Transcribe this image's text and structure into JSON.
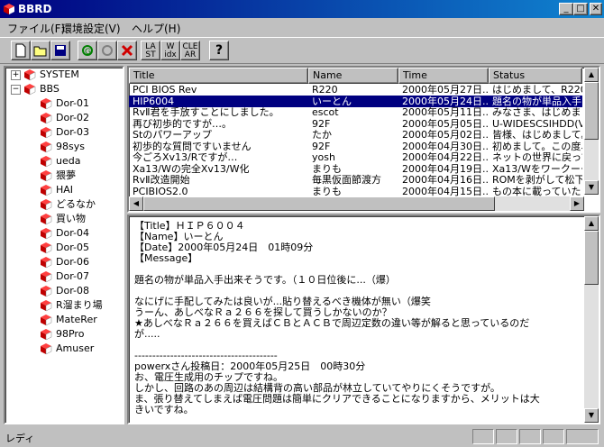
{
  "window": {
    "title": "BBRD"
  },
  "menu": [
    {
      "label": "ファイル(F)"
    },
    {
      "label": "環境設定(V)"
    },
    {
      "label": "ヘルプ(H)"
    }
  ],
  "toolbar": {
    "buttons": [
      {
        "icon": "new-file-icon"
      },
      {
        "icon": "open-folder-icon"
      },
      {
        "icon": "save-icon"
      },
      {
        "icon": "refresh-green-icon"
      },
      {
        "icon": "refresh-gray-icon"
      },
      {
        "icon": "delete-red-x-icon",
        "color": "#d00000"
      },
      {
        "icon": "last-icon",
        "label": "LA ST"
      },
      {
        "icon": "index-icon",
        "label": "W idx"
      },
      {
        "icon": "clear-icon",
        "label": "CLE AR"
      },
      {
        "icon": "help-icon",
        "label": "?"
      }
    ]
  },
  "tree": {
    "root1": "SYSTEM",
    "root2": "BBS",
    "children": [
      "Dor-01",
      "Dor-02",
      "Dor-03",
      "98sys",
      "ueda",
      "猥夢",
      "HAI",
      "どるなか",
      "買い物",
      "Dor-04",
      "Dor-05",
      "Dor-06",
      "Dor-07",
      "Dor-08",
      "R溜まり場",
      "MateRer",
      "98Pro",
      "Amuser"
    ]
  },
  "list": {
    "columns": [
      "Title",
      "Name",
      "Time",
      "Status"
    ],
    "rows": [
      {
        "title": "PCI BIOS Rev",
        "name": "R220",
        "time": "2000年05月27日...",
        "status": "はじめまして、R220と"
      },
      {
        "title": "HIP6004",
        "name": "いーとん",
        "time": "2000年05月24日...",
        "status": "題名の物が単品入手出"
      },
      {
        "title": "RvⅡ君を手放すことにしました。",
        "name": "escot",
        "time": "2000年05月11日...",
        "status": "みなさま、はじめまして"
      },
      {
        "title": "再び初歩的ですが…。",
        "name": "92F",
        "time": "2000年05月05日...",
        "status": "U-WIDESCSIHDD(VX"
      },
      {
        "title": "Stのパワーアップ",
        "name": "たか",
        "time": "2000年05月02日...",
        "status": "皆様、はじめまして。"
      },
      {
        "title": "初歩的な質問ですいません",
        "name": "92F",
        "time": "2000年04月30日...",
        "status": "初めまして。この度、と"
      },
      {
        "title": "今ごろXv13/Rですが…",
        "name": "yosh",
        "time": "2000年04月22日...",
        "status": "ネットの世界に戻ってき"
      },
      {
        "title": "Xa13/Wの完全Xv13/W化",
        "name": "まりも",
        "time": "2000年04月19日...",
        "status": "Xa13/Wをワークーーズ"
      },
      {
        "title": "RvⅡ改造開始",
        "name": "毎黒仮面節渡方",
        "time": "2000年04月16日...",
        "status": "ROMを剥がして松下製"
      },
      {
        "title": "PCIBIOS2.0",
        "name": "まりも",
        "time": "2000年04月15日...",
        "status": "もの本に載っていた"
      }
    ]
  },
  "message": {
    "lines": [
      "【Title】ＨＩＰ６００４",
      "【Name】いーとん",
      "【Date】2000年05月24日　01時09分",
      "【Message】",
      "",
      "題名の物が単品入手出来そうです。（１０日位後に...（爆）",
      "",
      "なにげに手配してみたは良いが...貼り替えるべき機体が無い（爆笑",
      "うーん、あしべなＲａ２６６を探して買うしかないのか？",
      "★あしべなＲａ２６６を買えばＣＢとＡＣＢで周辺定数の違い等が解ると思っているのだ",
      "が.....",
      "",
      "----------------------------------------",
      "powerxさん投稿日：2000年05月25日　00時30分",
      "お、電圧生成用のチップですね。",
      "しかし、回路のあの周辺は結構背の高い部品が林立していてやりにくそうですが。",
      "ま、張り替えてしまえば電圧問題は簡単にクリアできることになりますから、メリットは大",
      "きいですね。"
    ]
  },
  "status": {
    "text": "レディ"
  }
}
